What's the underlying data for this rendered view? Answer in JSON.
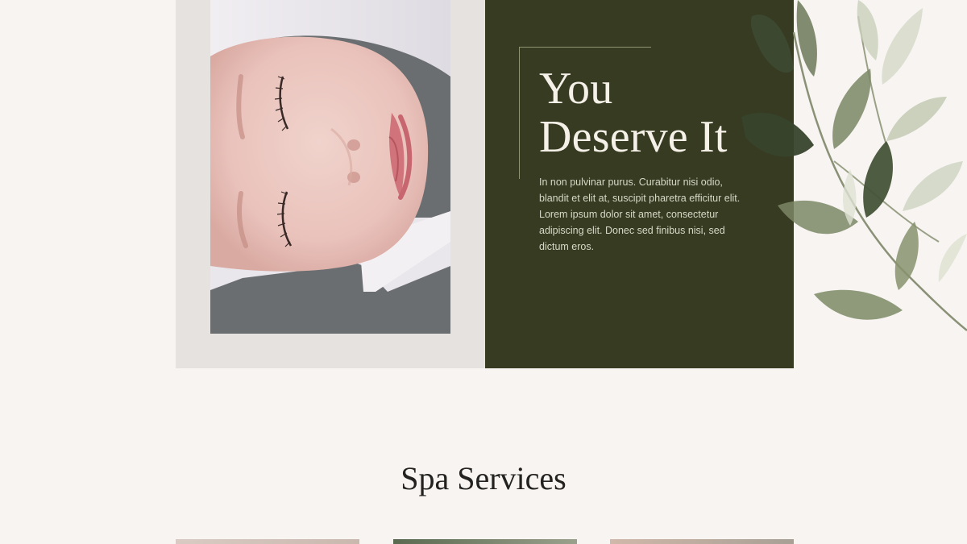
{
  "hero": {
    "title_line1": "You",
    "title_line2": "Deserve It",
    "body": "In non pulvinar purus. Curabitur nisi odio, blandit et elit at, suscipit pharetra efficitur elit. Lorem ipsum dolor sit amet, consectetur adipiscing elit. Donec sed finibus nisi, sed dictum eros."
  },
  "services": {
    "heading": "Spa Services"
  },
  "colors": {
    "page_background": "#f7f4f1",
    "hero_dark_green": "#363b21",
    "photo_panel_beige": "#e6e2df",
    "hero_title": "#f5f1e8",
    "heading_text": "#232220"
  },
  "images": {
    "hero_photo": "woman-face-spa-photo",
    "leaves": "watercolor-eucalyptus-leaves",
    "service_cards": [
      "service-photo-1",
      "service-photo-2",
      "service-photo-3"
    ]
  }
}
